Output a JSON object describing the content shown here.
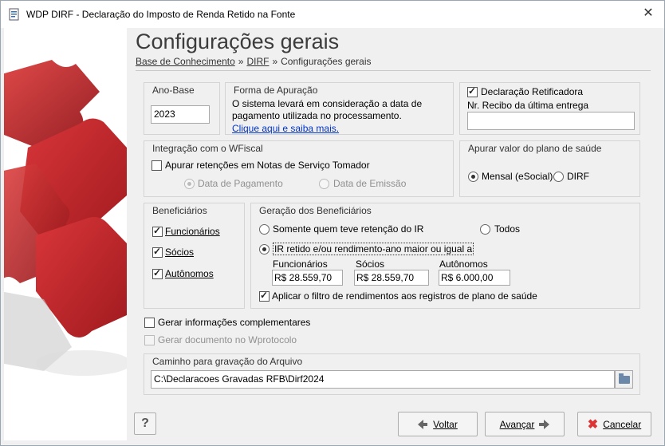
{
  "window": {
    "title": "WDP DIRF - Declaração do Imposto de Renda Retido na Fonte",
    "close_glyph": "✕"
  },
  "header": {
    "title": "Configurações gerais",
    "breadcrumb": [
      "Base de Conhecimento",
      "DIRF",
      "Configurações gerais"
    ],
    "breadcrumb_sep": "»"
  },
  "ano_base": {
    "label": "Ano-Base",
    "value": "2023"
  },
  "forma_apuracao": {
    "label": "Forma de Apuração",
    "text_line1": "O sistema levará em consideração a data de",
    "text_line2": "pagamento utilizada no processamento.",
    "link": "Clique aqui e saiba mais."
  },
  "retificadora": {
    "checkbox_label": "Declaração Retificadora",
    "checked": true,
    "recibo_label": "Nr. Recibo da última entrega",
    "recibo_value": ""
  },
  "wfiscal": {
    "label": "Integração com o WFiscal",
    "checkbox_label": "Apurar retenções em Notas de Serviço Tomador",
    "radio_pagamento": "Data de Pagamento",
    "radio_emissao": "Data de Emissão"
  },
  "plano_saude": {
    "label": "Apurar valor do plano de saúde",
    "radio_mensal": "Mensal (eSocial)",
    "radio_dirf": "DIRF"
  },
  "beneficiarios": {
    "label": "Beneficiários",
    "items": [
      "Funcionários",
      "Sócios",
      "Autônomos"
    ]
  },
  "geracao": {
    "label": "Geração dos Beneficiários",
    "radio_somente": "Somente quem teve retenção do IR",
    "radio_todos": "Todos",
    "radio_ir": "IR retido e/ou rendimento-ano maior ou igual a",
    "funcionarios_label": "Funcionários",
    "funcionarios_value": "R$ 28.559,70",
    "socios_label": "Sócios",
    "socios_value": "R$ 28.559,70",
    "autonomos_label": "Autônomos",
    "autonomos_value": "R$ 6.000,00",
    "aplicar_label": "Aplicar o filtro de rendimentos aos registros de plano de saúde"
  },
  "extras": {
    "complementares": "Gerar informações complementares",
    "wprotocolo": "Gerar documento no Wprotocolo"
  },
  "caminho": {
    "label": "Caminho para gravação do Arquivo",
    "value": "C:\\Declaracoes Gravadas RFB\\Dirf2024"
  },
  "buttons": {
    "help": "?",
    "voltar": "Voltar",
    "avancar": "Avançar",
    "cancelar": "Cancelar"
  },
  "colors": {
    "link": "#0033cc",
    "cancel_icon": "#d33333",
    "puzzle": "#c0252a"
  }
}
